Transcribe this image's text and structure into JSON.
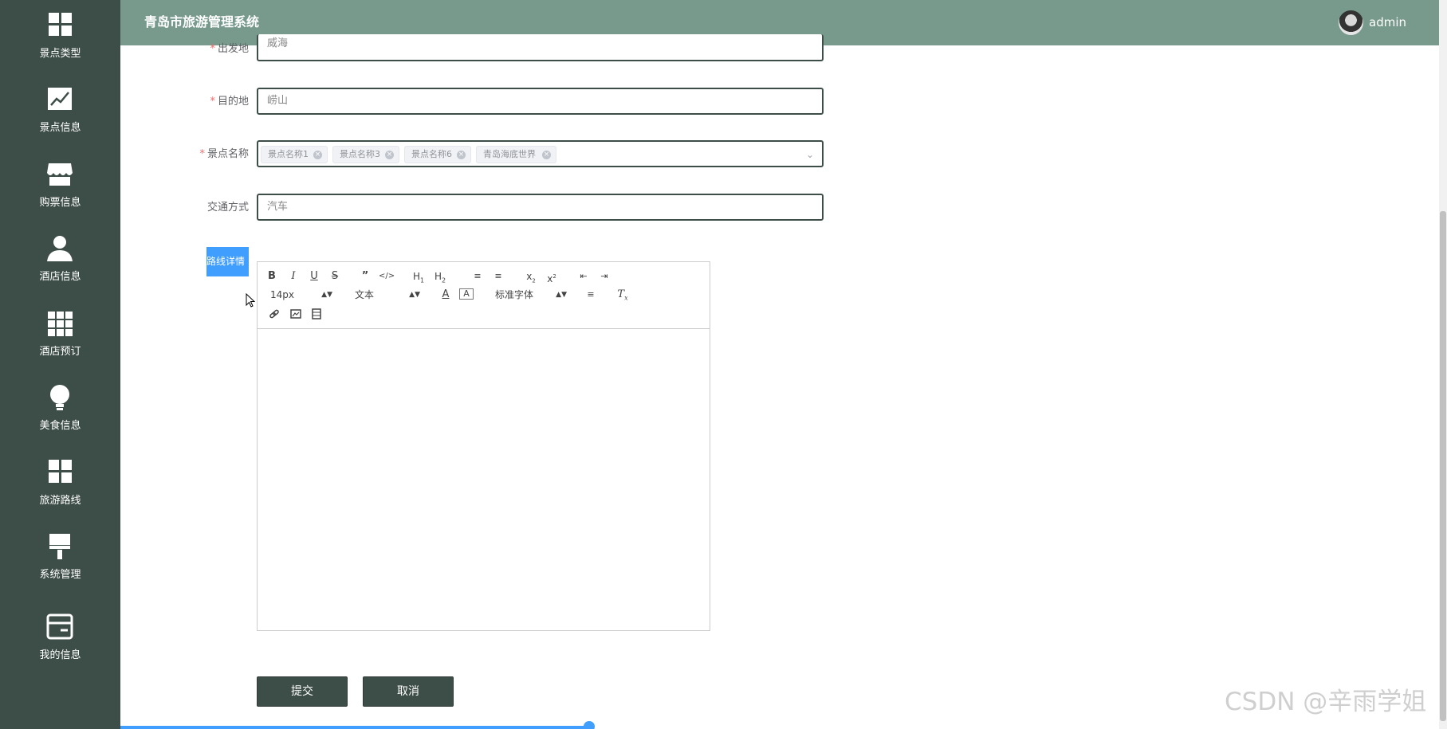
{
  "header": {
    "title": "青岛市旅游管理系统",
    "username": "admin"
  },
  "sidebar": {
    "items": [
      {
        "label": "景点类型",
        "icon": "grid-icon"
      },
      {
        "label": "景点信息",
        "icon": "trend-chart-icon"
      },
      {
        "label": "购票信息",
        "icon": "shop-icon"
      },
      {
        "label": "酒店信息",
        "icon": "user-icon"
      },
      {
        "label": "酒店预订",
        "icon": "grid-nine-icon"
      },
      {
        "label": "美食信息",
        "icon": "bulb-icon"
      },
      {
        "label": "旅游路线",
        "icon": "grid-icon"
      },
      {
        "label": "系统管理",
        "icon": "brush-icon"
      },
      {
        "label": "我的信息",
        "icon": "card-icon"
      }
    ]
  },
  "form": {
    "departure": {
      "label": "出发地",
      "value": "威海",
      "required": true
    },
    "destination": {
      "label": "目的地",
      "value": "崂山",
      "required": true
    },
    "spots": {
      "label": "景点名称",
      "required": true,
      "tags": [
        "景点名称1",
        "景点名称3",
        "景点名称6",
        "青岛海底世界"
      ]
    },
    "transport": {
      "label": "交通方式",
      "value": "汽车",
      "required": false
    },
    "route_detail": {
      "label": "路线详情"
    }
  },
  "editor": {
    "font_size": "14px",
    "block_format": "文本",
    "font_family": "标准字体"
  },
  "buttons": {
    "submit": "提交",
    "cancel": "取消"
  },
  "watermark": "CSDN @辛雨学姐",
  "colors": {
    "sidebar": "#3d4d48",
    "header": "#779a8c",
    "primary": "#409eff",
    "required": "#f56c6c"
  }
}
